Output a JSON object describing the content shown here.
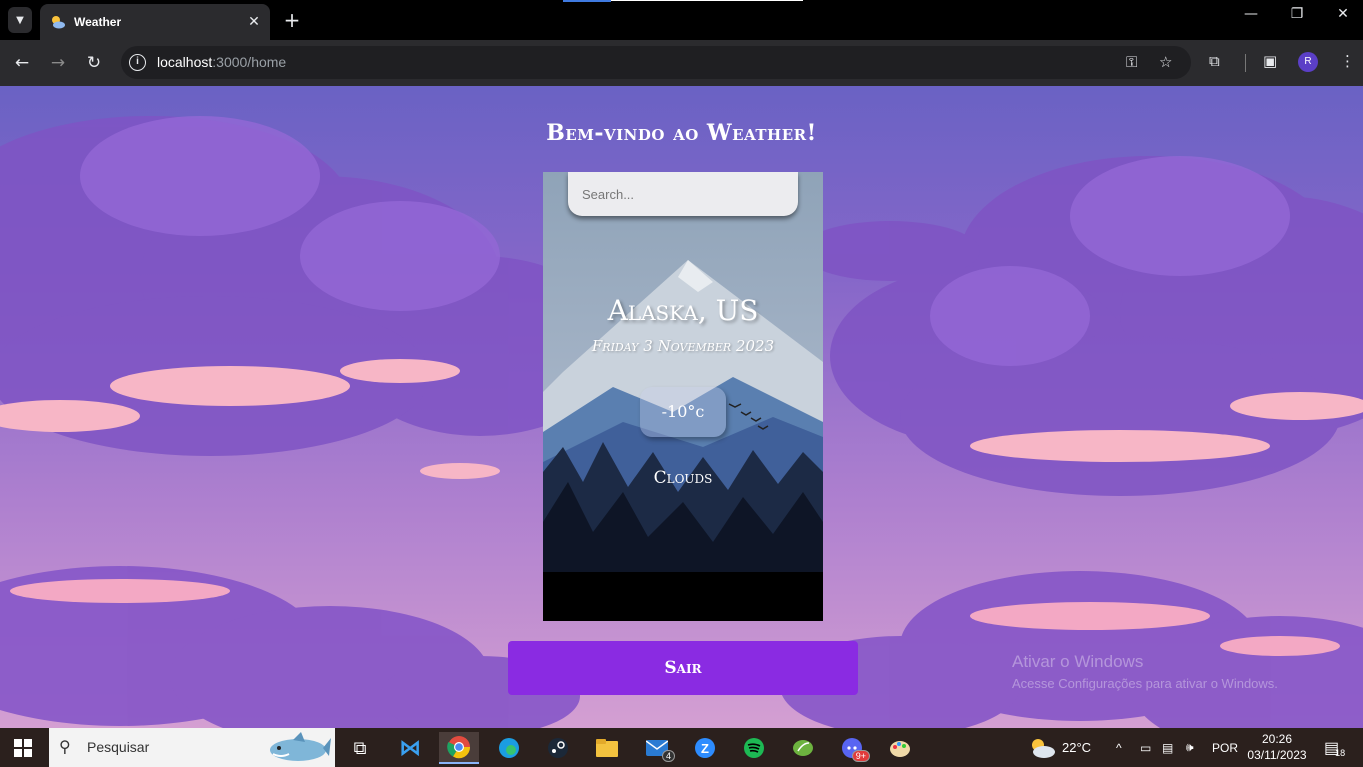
{
  "browser": {
    "tab_title": "Weather",
    "url_host": "localhost",
    "url_path": ":3000/home",
    "profile_initial": "R"
  },
  "page": {
    "welcome": "Bem-vindo ao Weather!",
    "search_placeholder": "Search...",
    "location": "Alaska, US",
    "date": "Friday 3 November 2023",
    "temperature": "-10°c",
    "condition": "Clouds",
    "logout_label": "Sair"
  },
  "watermark": {
    "line1": "Ativar o Windows",
    "line2": "Acesse Configurações para ativar o Windows."
  },
  "taskbar": {
    "search_label": "Pesquisar",
    "weather_temp": "22°C",
    "language": "POR",
    "time": "20:26",
    "date": "03/11/2023",
    "notification_count": "18",
    "mail_badge": "4",
    "discord_badge": "9+"
  },
  "colors": {
    "sky_top": "#6a62c4",
    "sky_bottom": "#d49fd2",
    "accent_button": "#8a2be2",
    "browser_chrome": "#2b2b2e"
  }
}
